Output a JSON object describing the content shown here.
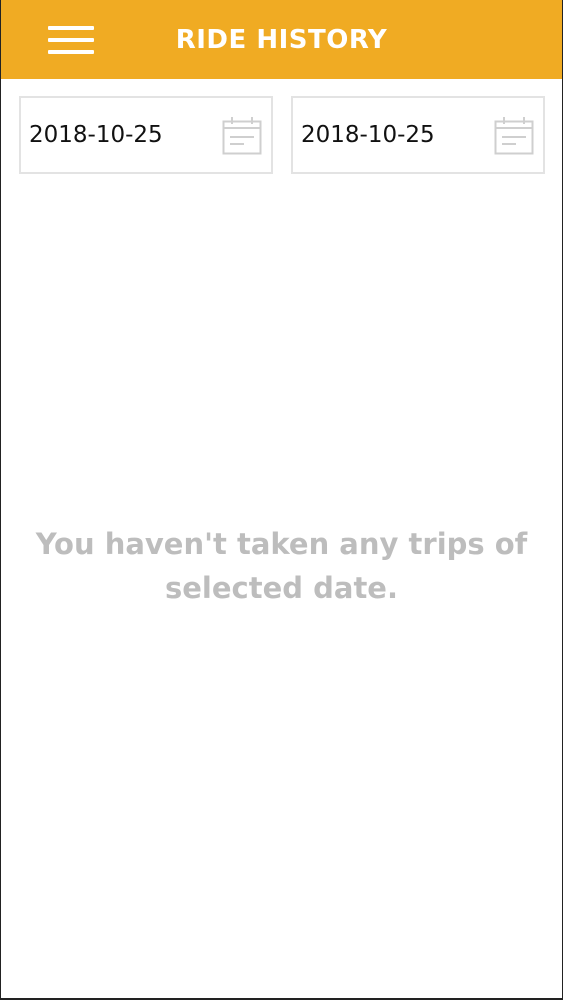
{
  "header": {
    "title": "RIDE HISTORY",
    "menu_icon": "hamburger-menu-icon",
    "background_color": "#f0ab23"
  },
  "date_range": {
    "from": {
      "value": "2018-10-25",
      "icon": "calendar-icon"
    },
    "to": {
      "value": "2018-10-25",
      "icon": "calendar-icon"
    }
  },
  "empty_state": {
    "message": "You haven't taken any trips of selected date."
  }
}
